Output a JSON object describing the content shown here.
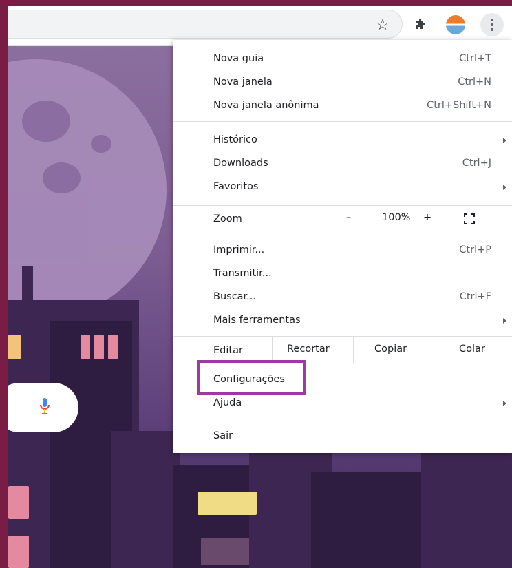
{
  "colors": {
    "frame_bg": "#7a1d45",
    "highlight_border": "#9c3aa0",
    "menu_bg": "#ffffff"
  },
  "toolbar": {
    "icons": [
      "star-icon",
      "extensions-icon",
      "profile-avatar",
      "more-vert-icon"
    ]
  },
  "menu": {
    "group1": [
      {
        "label": "Nova guia",
        "shortcut": "Ctrl+T"
      },
      {
        "label": "Nova janela",
        "shortcut": "Ctrl+N"
      },
      {
        "label": "Nova janela anônima",
        "shortcut": "Ctrl+Shift+N"
      }
    ],
    "group2": [
      {
        "label": "Histórico",
        "shortcut": ""
      },
      {
        "label": "Downloads",
        "shortcut": "Ctrl+J"
      },
      {
        "label": "Favoritos",
        "shortcut": ""
      }
    ],
    "zoom": {
      "label": "Zoom",
      "minus": "–",
      "value": "100%",
      "plus": "+"
    },
    "group3": [
      {
        "label": "Imprimir...",
        "shortcut": "Ctrl+P"
      },
      {
        "label": "Transmitir...",
        "shortcut": ""
      },
      {
        "label": "Buscar...",
        "shortcut": "Ctrl+F"
      },
      {
        "label": "Mais ferramentas",
        "shortcut": ""
      }
    ],
    "edit": {
      "label": "Editar",
      "cut": "Recortar",
      "copy": "Copiar",
      "paste": "Colar"
    },
    "group4": [
      {
        "label": "Configurações",
        "shortcut": ""
      },
      {
        "label": "Ajuda",
        "shortcut": ""
      }
    ],
    "exit": "Sair"
  }
}
